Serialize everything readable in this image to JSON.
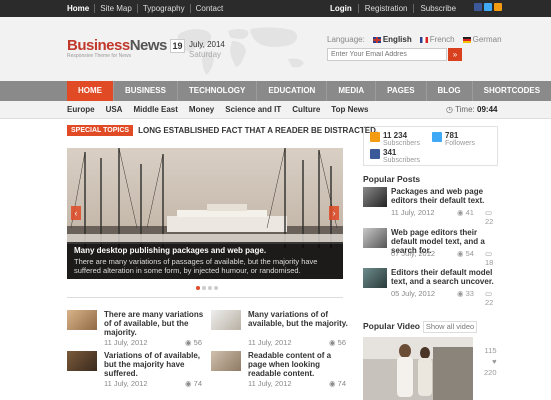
{
  "topbar": {
    "links": [
      "Home",
      "Site Map",
      "Typography",
      "Contact"
    ],
    "account": [
      "Login",
      "Registration",
      "Subscribe"
    ],
    "social_icons": [
      "facebook-icon",
      "twitter-icon",
      "rss-icon"
    ]
  },
  "header": {
    "logo_a": "Business",
    "logo_b": "News",
    "tagline": "Responsive Theme for News",
    "day": "19",
    "month_year": "July, 2014",
    "weekday": "Saturday",
    "language_label": "Language:",
    "languages": [
      {
        "label": "English",
        "active": true
      },
      {
        "label": "French",
        "active": false
      },
      {
        "label": "German",
        "active": false
      }
    ],
    "email_placeholder": "Enter Your Email Addres",
    "email_button": "»"
  },
  "mainnav": [
    "HOME",
    "BUSINESS",
    "TECHNOLOGY",
    "EDUCATION",
    "MEDIA",
    "PAGES",
    "BLOG",
    "SHORTCODES"
  ],
  "subnav": {
    "items": [
      "Europe",
      "USA",
      "Middle East",
      "Money",
      "Science and IT",
      "Culture",
      "Top News"
    ],
    "time_label": "Time:",
    "time_value": "09:44"
  },
  "special": {
    "badge": "SPECIAL TOPICS",
    "text": "LONG ESTABLISHED FACT THAT A READER BE DISTRACTED."
  },
  "slider": {
    "title": "Many desktop publishing packages and web page.",
    "desc": "There are many variations of passages of available, but the majority have suffered alteration in some form, by injected humour, or randomised.",
    "prev": "‹",
    "next": "›"
  },
  "articles": [
    {
      "title": "There are many variations of of available, but the majority.",
      "date": "11 July, 2012",
      "views": "56"
    },
    {
      "title": "Many variations of of available, but the majority.",
      "date": "11 July, 2012",
      "views": "56"
    },
    {
      "title": "Variations of of available, but the majority have suffered.",
      "date": "11 July, 2012",
      "views": "74"
    },
    {
      "title": "Readable content of a page when looking readable content.",
      "date": "11 July, 2012",
      "views": "74"
    }
  ],
  "counters": {
    "rss_num": "11 234",
    "rss_lbl": "Subscribers",
    "tw_num": "781",
    "tw_lbl": "Followers",
    "fb_num": "341",
    "fb_lbl": "Subscribers"
  },
  "popular": {
    "title": "Popular Posts",
    "posts": [
      {
        "title": "Packages and web page editors their default text.",
        "date": "11 July, 2012",
        "views": "41",
        "comments": "22"
      },
      {
        "title": "Web page editors their default model text, and a search for.",
        "date": "07 July, 2012",
        "views": "54",
        "comments": "18"
      },
      {
        "title": "Editors their default model text, and a search uncover.",
        "date": "05 July, 2012",
        "views": "33",
        "comments": "22"
      }
    ]
  },
  "video": {
    "title": "Popular Video",
    "show_all": "Show all video",
    "stat1": "115",
    "stat2": "220"
  }
}
